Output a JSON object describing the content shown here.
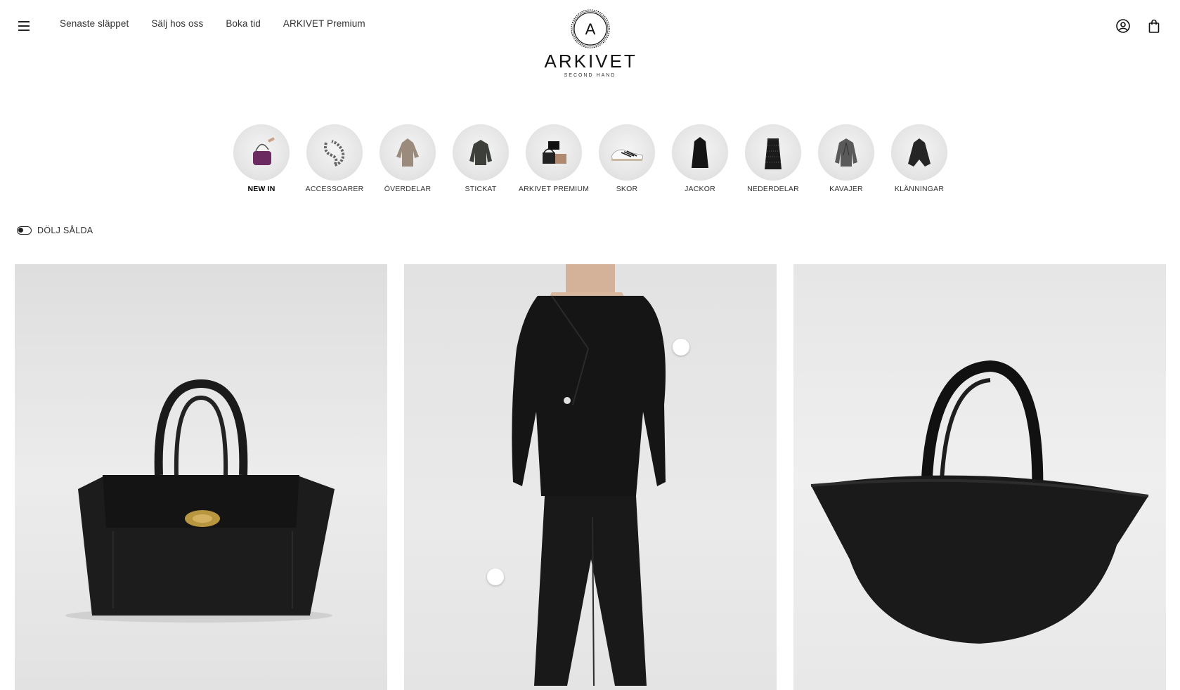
{
  "header": {
    "nav": [
      "Senaste släppet",
      "Sälj hos oss",
      "Boka tid",
      "ARKIVET Premium"
    ],
    "logo": {
      "badge_letter": "A",
      "wordmark": "ARKIVET",
      "tagline": "SECOND HAND"
    }
  },
  "categories": [
    {
      "label": "NEW IN",
      "active": true,
      "icon": "purple-handbag"
    },
    {
      "label": "ACCESSOARER",
      "active": false,
      "icon": "chain-necklace"
    },
    {
      "label": "ÖVERDELAR",
      "active": false,
      "icon": "beige-shirt"
    },
    {
      "label": "STICKAT",
      "active": false,
      "icon": "dark-sweater"
    },
    {
      "label": "ARKIVET PREMIUM",
      "active": false,
      "icon": "designer-bags"
    },
    {
      "label": "SKOR",
      "active": false,
      "icon": "sneaker"
    },
    {
      "label": "JACKOR",
      "active": false,
      "icon": "black-coat"
    },
    {
      "label": "NEDERDELAR",
      "active": false,
      "icon": "sequin-skirt"
    },
    {
      "label": "KAVAJER",
      "active": false,
      "icon": "grey-blazer"
    },
    {
      "label": "KLÄNNINGAR",
      "active": false,
      "icon": "black-dress"
    }
  ],
  "filter": {
    "label": "DÖLJ SÅLDA",
    "enabled": false
  },
  "products": [
    {
      "image": "black-leather-tote-with-gold-clasp"
    },
    {
      "image": "model-in-black-wrap-jacket-and-trousers"
    },
    {
      "image": "black-leather-basket-bag"
    }
  ],
  "colors": {
    "accent": "#111111",
    "text": "#333333",
    "card_bg": "#e4e4e4"
  }
}
